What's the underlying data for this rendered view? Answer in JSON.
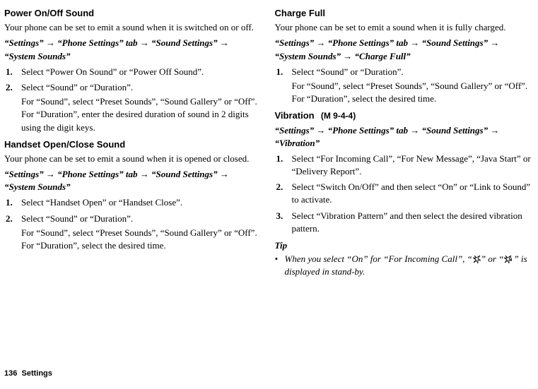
{
  "left": {
    "section1": {
      "title": "Power On/Off Sound",
      "intro": "Your phone can be set to emit a sound when it is switched on or off.",
      "path": "“Settings” → “Phone Settings” tab → “Sound Settings” → “System Sounds”",
      "step1": "Select “Power On Sound” or “Power Off Sound”.",
      "step2": "Select “Sound” or “Duration”.",
      "step2sub": "For “Sound”, select “Preset Sounds”, “Sound Gallery” or “Off”.\nFor “Duration”, enter the desired duration of sound in 2 digits using the digit keys."
    },
    "section2": {
      "title": "Handset Open/Close Sound",
      "intro": "Your phone can be set to emit a sound when it is opened or closed.",
      "path": "“Settings” → “Phone Settings” tab → “Sound Settings” → “System Sounds”",
      "step1": "Select “Handset Open” or “Handset Close”.",
      "step2": "Select “Sound” or “Duration”.",
      "step2sub": "For “Sound”, select “Preset Sounds”, “Sound Gallery” or “Off”.\nFor “Duration”, select the desired time."
    }
  },
  "right": {
    "section1": {
      "title": "Charge Full",
      "intro": "Your phone can be set to emit a sound when it is fully charged.",
      "path": "“Settings” → “Phone Settings” tab → “Sound Settings” → “System Sounds” → “Charge Full”",
      "step1": "Select “Sound” or “Duration”.",
      "step1sub": "For “Sound”, select “Preset Sounds”, “Sound Gallery” or “Off”.\nFor “Duration”, select the desired time."
    },
    "section2": {
      "title": "Vibration",
      "menucode": "(M 9-4-4)",
      "path": "“Settings” → “Phone Settings” tab → “Sound Settings” → “Vibration”",
      "step1": "Select “For Incoming Call”, “For New Message”, “Java Start” or “Delivery Report”.",
      "step2": "Select “Switch On/Off” and then select “On” or “Link to Sound” to activate.",
      "step3": "Select “Vibration Pattern” and then select the desired vibration pattern.",
      "tiplabel": "Tip",
      "tipbullet": "•",
      "tip_pre": "When you select “On” for “For Incoming Call”, “",
      "tip_mid": "” or “",
      "tip_post": "” is displayed in stand-by."
    }
  },
  "footer": {
    "page": "136",
    "chapter": "Settings"
  },
  "steps": {
    "n1": "1.",
    "n2": "2.",
    "n3": "3."
  }
}
